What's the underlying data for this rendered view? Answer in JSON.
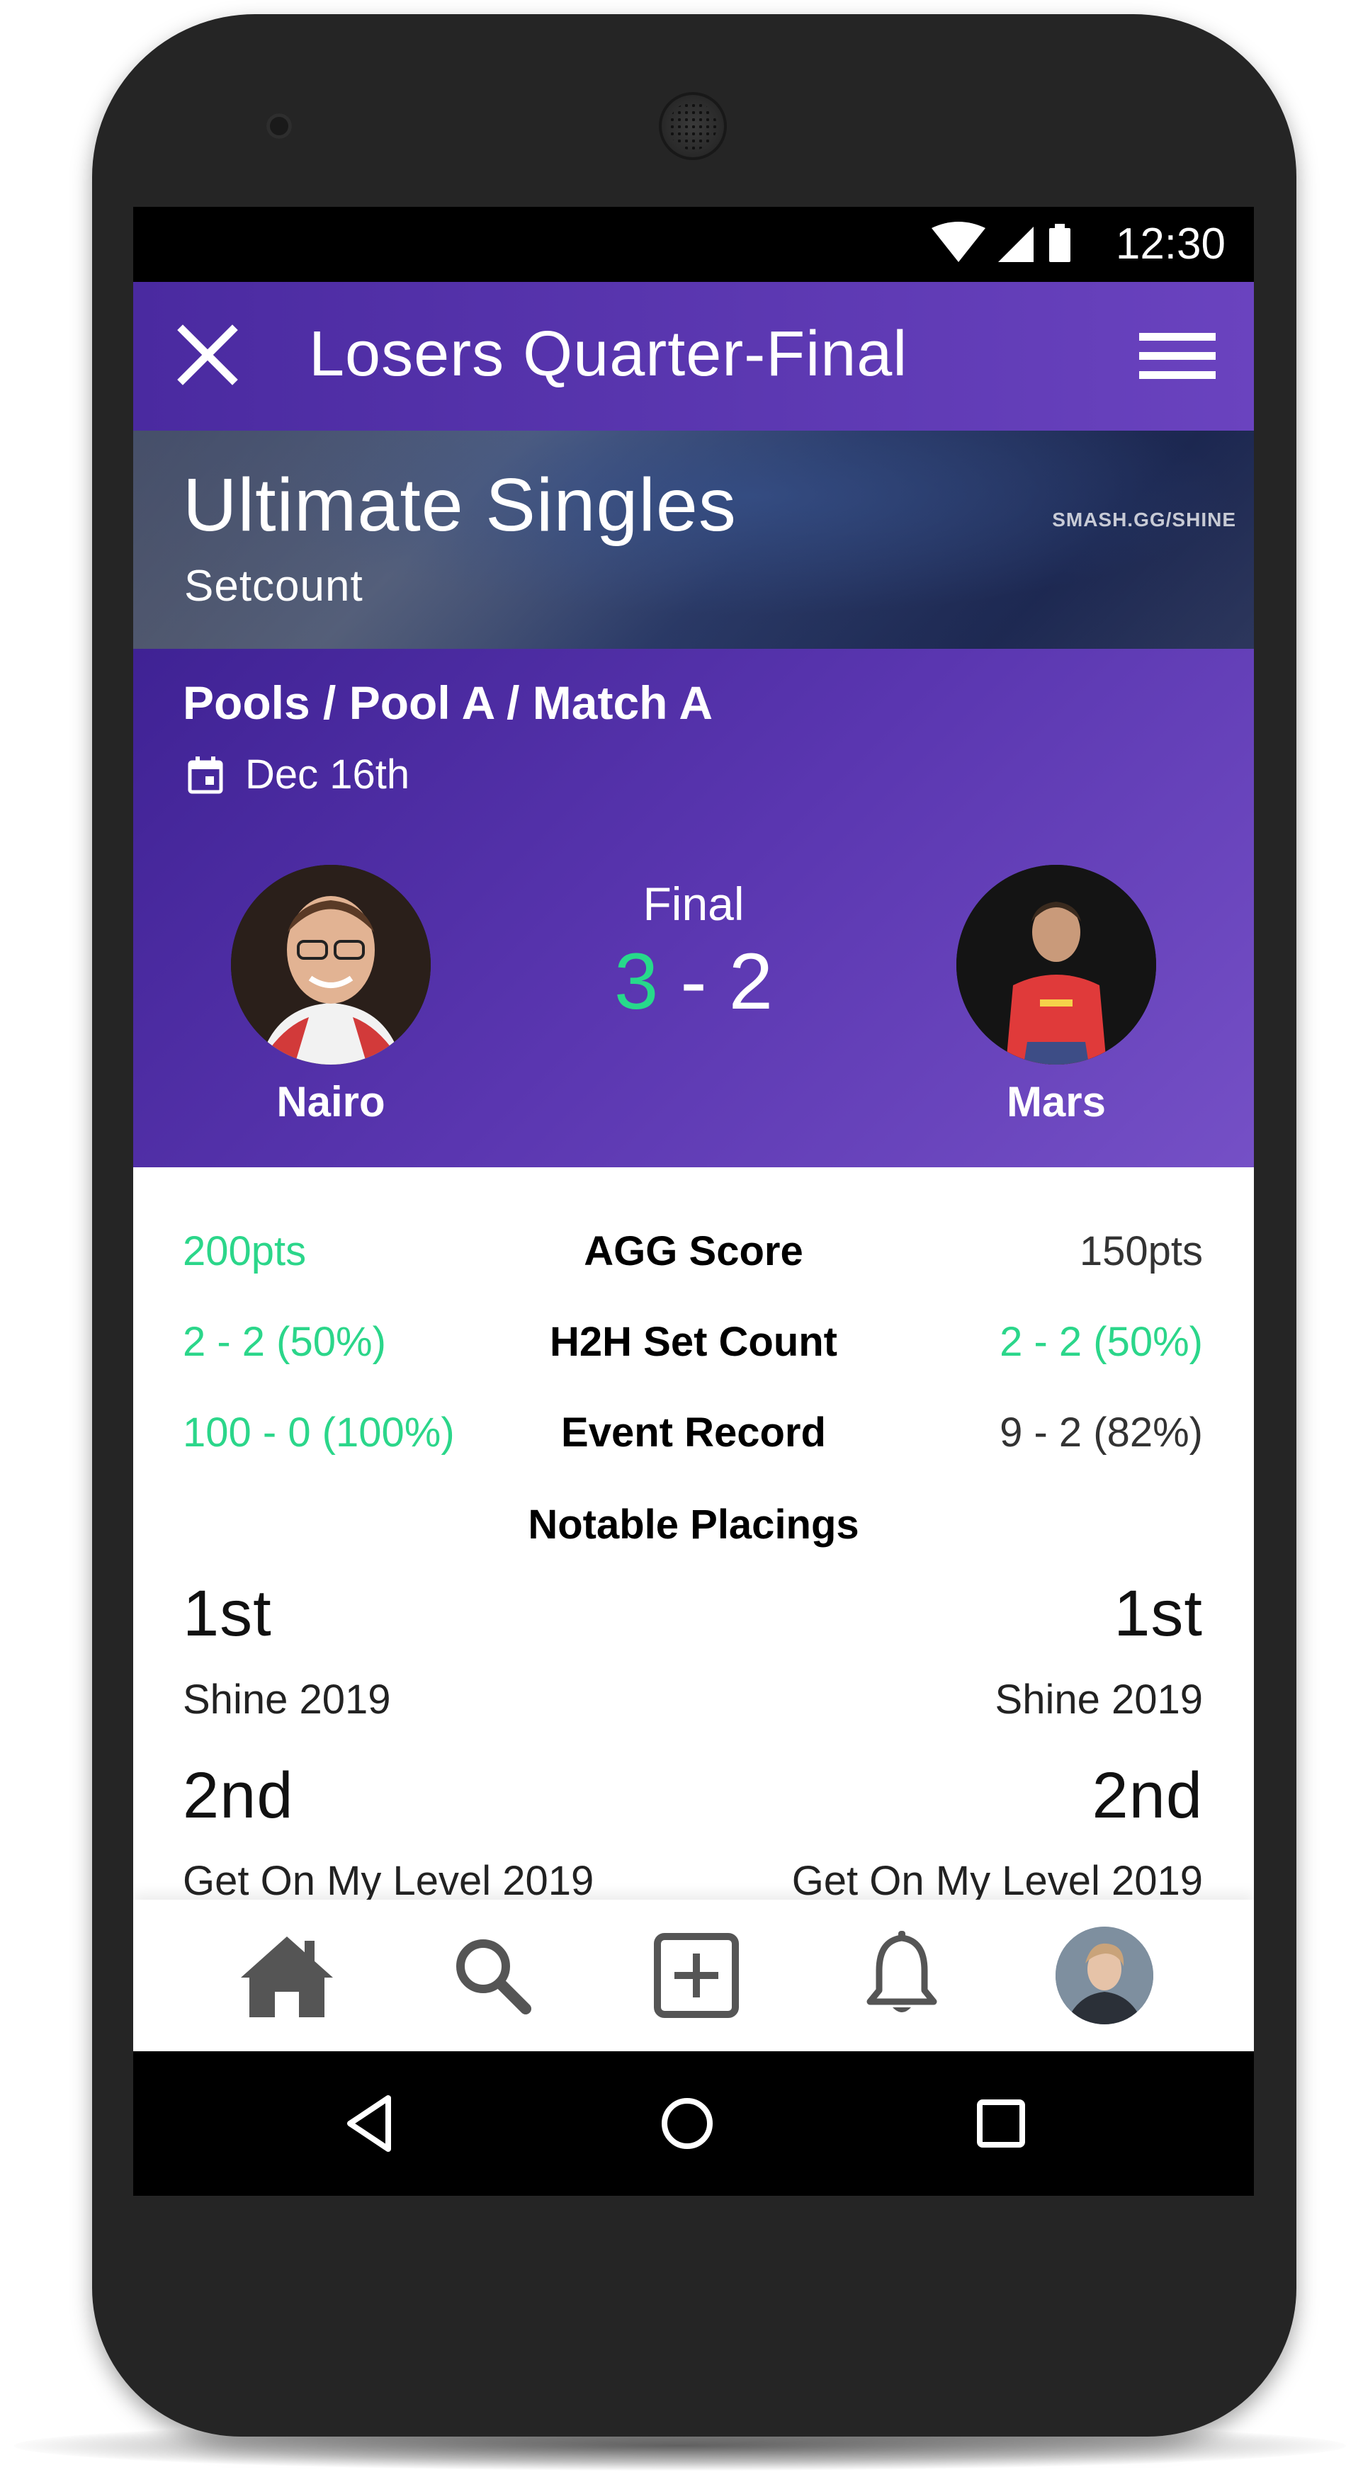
{
  "status_bar": {
    "time": "12:30"
  },
  "app_bar": {
    "title": "Losers Quarter-Final"
  },
  "banner": {
    "title": "Ultimate Singles",
    "subtitle": "Setcount",
    "watermark": "SMASH.GG/SHINE"
  },
  "match": {
    "breadcrumb": "Pools / Pool A / Match A",
    "date": "Dec 16th",
    "status": "Final",
    "score_left": "3",
    "score_separator": " - ",
    "score_right": "2",
    "player_left": "Nairo",
    "player_right": "Mars"
  },
  "stats": [
    {
      "label": "AGG Score",
      "left": "200pts",
      "right": "150pts",
      "left_highlight": true,
      "right_highlight": false
    },
    {
      "label": "H2H Set Count",
      "left": "2 - 2 (50%)",
      "right": "2 - 2 (50%)",
      "left_highlight": true,
      "right_highlight": true
    },
    {
      "label": "Event Record",
      "left": "100 - 0 (100%)",
      "right": "9 - 2 (82%)",
      "left_highlight": true,
      "right_highlight": false
    }
  ],
  "notable_placings": {
    "heading": "Notable Placings",
    "left": [
      {
        "place": "1st",
        "event": "Shine 2019"
      },
      {
        "place": "2nd",
        "event": "Get On My Level 2019"
      }
    ],
    "right": [
      {
        "place": "1st",
        "event": "Shine 2019"
      },
      {
        "place": "2nd",
        "event": "Get On My Level 2019"
      }
    ]
  },
  "bottom_nav": [
    "home-icon",
    "search-icon",
    "add-box-icon",
    "bell-icon",
    "profile-avatar"
  ],
  "system_nav": [
    "back-icon",
    "home-circle-icon",
    "recents-icon"
  ],
  "colors": {
    "accent_purple": "#5a36b0",
    "highlight_green": "#2bd68a",
    "icon_gray": "#555555"
  }
}
